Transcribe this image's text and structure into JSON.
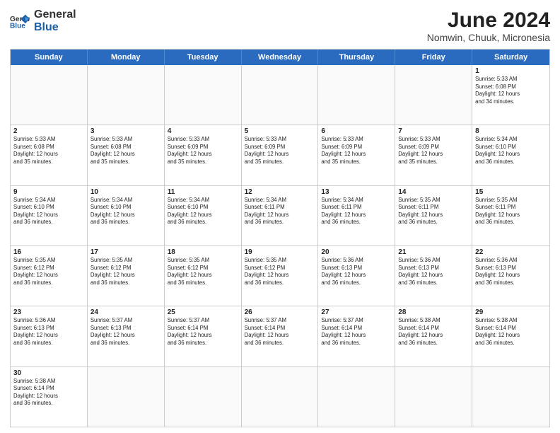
{
  "header": {
    "logo_general": "General",
    "logo_blue": "Blue",
    "month_year": "June 2024",
    "location": "Nomwin, Chuuk, Micronesia"
  },
  "days": {
    "headers": [
      "Sunday",
      "Monday",
      "Tuesday",
      "Wednesday",
      "Thursday",
      "Friday",
      "Saturday"
    ]
  },
  "weeks": [
    [
      {
        "num": "",
        "info": "",
        "empty": true
      },
      {
        "num": "",
        "info": "",
        "empty": true
      },
      {
        "num": "",
        "info": "",
        "empty": true
      },
      {
        "num": "",
        "info": "",
        "empty": true
      },
      {
        "num": "",
        "info": "",
        "empty": true
      },
      {
        "num": "",
        "info": "",
        "empty": true
      },
      {
        "num": "1",
        "info": "Sunrise: 5:33 AM\nSunset: 6:08 PM\nDaylight: 12 hours\nand 34 minutes."
      }
    ],
    [
      {
        "num": "2",
        "info": "Sunrise: 5:33 AM\nSunset: 6:08 PM\nDaylight: 12 hours\nand 35 minutes."
      },
      {
        "num": "3",
        "info": "Sunrise: 5:33 AM\nSunset: 6:08 PM\nDaylight: 12 hours\nand 35 minutes."
      },
      {
        "num": "4",
        "info": "Sunrise: 5:33 AM\nSunset: 6:09 PM\nDaylight: 12 hours\nand 35 minutes."
      },
      {
        "num": "5",
        "info": "Sunrise: 5:33 AM\nSunset: 6:09 PM\nDaylight: 12 hours\nand 35 minutes."
      },
      {
        "num": "6",
        "info": "Sunrise: 5:33 AM\nSunset: 6:09 PM\nDaylight: 12 hours\nand 35 minutes."
      },
      {
        "num": "7",
        "info": "Sunrise: 5:33 AM\nSunset: 6:09 PM\nDaylight: 12 hours\nand 35 minutes."
      },
      {
        "num": "8",
        "info": "Sunrise: 5:34 AM\nSunset: 6:10 PM\nDaylight: 12 hours\nand 36 minutes."
      }
    ],
    [
      {
        "num": "9",
        "info": "Sunrise: 5:34 AM\nSunset: 6:10 PM\nDaylight: 12 hours\nand 36 minutes."
      },
      {
        "num": "10",
        "info": "Sunrise: 5:34 AM\nSunset: 6:10 PM\nDaylight: 12 hours\nand 36 minutes."
      },
      {
        "num": "11",
        "info": "Sunrise: 5:34 AM\nSunset: 6:10 PM\nDaylight: 12 hours\nand 36 minutes."
      },
      {
        "num": "12",
        "info": "Sunrise: 5:34 AM\nSunset: 6:11 PM\nDaylight: 12 hours\nand 36 minutes."
      },
      {
        "num": "13",
        "info": "Sunrise: 5:34 AM\nSunset: 6:11 PM\nDaylight: 12 hours\nand 36 minutes."
      },
      {
        "num": "14",
        "info": "Sunrise: 5:35 AM\nSunset: 6:11 PM\nDaylight: 12 hours\nand 36 minutes."
      },
      {
        "num": "15",
        "info": "Sunrise: 5:35 AM\nSunset: 6:11 PM\nDaylight: 12 hours\nand 36 minutes."
      }
    ],
    [
      {
        "num": "16",
        "info": "Sunrise: 5:35 AM\nSunset: 6:12 PM\nDaylight: 12 hours\nand 36 minutes."
      },
      {
        "num": "17",
        "info": "Sunrise: 5:35 AM\nSunset: 6:12 PM\nDaylight: 12 hours\nand 36 minutes."
      },
      {
        "num": "18",
        "info": "Sunrise: 5:35 AM\nSunset: 6:12 PM\nDaylight: 12 hours\nand 36 minutes."
      },
      {
        "num": "19",
        "info": "Sunrise: 5:35 AM\nSunset: 6:12 PM\nDaylight: 12 hours\nand 36 minutes."
      },
      {
        "num": "20",
        "info": "Sunrise: 5:36 AM\nSunset: 6:13 PM\nDaylight: 12 hours\nand 36 minutes."
      },
      {
        "num": "21",
        "info": "Sunrise: 5:36 AM\nSunset: 6:13 PM\nDaylight: 12 hours\nand 36 minutes."
      },
      {
        "num": "22",
        "info": "Sunrise: 5:36 AM\nSunset: 6:13 PM\nDaylight: 12 hours\nand 36 minutes."
      }
    ],
    [
      {
        "num": "23",
        "info": "Sunrise: 5:36 AM\nSunset: 6:13 PM\nDaylight: 12 hours\nand 36 minutes."
      },
      {
        "num": "24",
        "info": "Sunrise: 5:37 AM\nSunset: 6:13 PM\nDaylight: 12 hours\nand 36 minutes."
      },
      {
        "num": "25",
        "info": "Sunrise: 5:37 AM\nSunset: 6:14 PM\nDaylight: 12 hours\nand 36 minutes."
      },
      {
        "num": "26",
        "info": "Sunrise: 5:37 AM\nSunset: 6:14 PM\nDaylight: 12 hours\nand 36 minutes."
      },
      {
        "num": "27",
        "info": "Sunrise: 5:37 AM\nSunset: 6:14 PM\nDaylight: 12 hours\nand 36 minutes."
      },
      {
        "num": "28",
        "info": "Sunrise: 5:38 AM\nSunset: 6:14 PM\nDaylight: 12 hours\nand 36 minutes."
      },
      {
        "num": "29",
        "info": "Sunrise: 5:38 AM\nSunset: 6:14 PM\nDaylight: 12 hours\nand 36 minutes."
      }
    ],
    [
      {
        "num": "30",
        "info": "Sunrise: 5:38 AM\nSunset: 6:14 PM\nDaylight: 12 hours\nand 36 minutes."
      },
      {
        "num": "",
        "info": "",
        "empty": true
      },
      {
        "num": "",
        "info": "",
        "empty": true
      },
      {
        "num": "",
        "info": "",
        "empty": true
      },
      {
        "num": "",
        "info": "",
        "empty": true
      },
      {
        "num": "",
        "info": "",
        "empty": true
      },
      {
        "num": "",
        "info": "",
        "empty": true
      }
    ]
  ]
}
